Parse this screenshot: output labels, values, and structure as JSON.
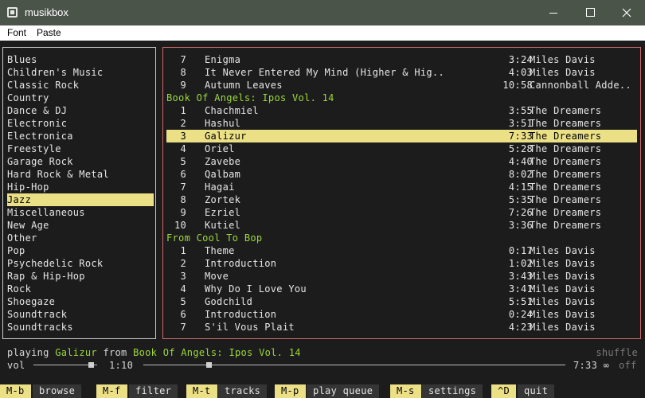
{
  "window": {
    "title": "musikbox"
  },
  "menu": {
    "font": "Font",
    "paste": "Paste"
  },
  "genres": [
    "Blues",
    "Children's Music",
    "Classic Rock",
    "Country",
    "Dance & DJ",
    "Electronic",
    "Electronica",
    "Freestyle",
    "Garage Rock",
    "Hard Rock & Metal",
    "Hip-Hop",
    "Jazz",
    "Miscellaneous",
    "New Age",
    "Other",
    "Pop",
    "Psychedelic Rock",
    "Rap & Hip-Hop",
    "Rock",
    "Shoegaze",
    "Soundtrack",
    "Soundtracks"
  ],
  "selected_genre": "Jazz",
  "tracks": [
    {
      "kind": "track",
      "num": "7",
      "title": "Enigma",
      "duration": "3:24",
      "artist": "Miles Davis"
    },
    {
      "kind": "track",
      "num": "8",
      "title": "It Never Entered My Mind (Higher & Hig..",
      "duration": "4:03",
      "artist": "Miles Davis"
    },
    {
      "kind": "track",
      "num": "9",
      "title": "Autumn Leaves",
      "duration": "10:58",
      "artist": "Cannonball Adde.."
    },
    {
      "kind": "album",
      "title": "Book Of Angels: Ipos Vol. 14"
    },
    {
      "kind": "track",
      "num": "1",
      "title": "Chachmiel",
      "duration": "3:55",
      "artist": "The Dreamers"
    },
    {
      "kind": "track",
      "num": "2",
      "title": "Hashul",
      "duration": "3:51",
      "artist": "The Dreamers"
    },
    {
      "kind": "track",
      "num": "3",
      "title": "Galizur",
      "duration": "7:33",
      "artist": "The Dreamers",
      "selected": true
    },
    {
      "kind": "track",
      "num": "4",
      "title": "Oriel",
      "duration": "5:28",
      "artist": "The Dreamers"
    },
    {
      "kind": "track",
      "num": "5",
      "title": "Zavebe",
      "duration": "4:40",
      "artist": "The Dreamers"
    },
    {
      "kind": "track",
      "num": "6",
      "title": "Qalbam",
      "duration": "8:02",
      "artist": "The Dreamers"
    },
    {
      "kind": "track",
      "num": "7",
      "title": "Hagai",
      "duration": "4:15",
      "artist": "The Dreamers"
    },
    {
      "kind": "track",
      "num": "8",
      "title": "Zortek",
      "duration": "5:35",
      "artist": "The Dreamers"
    },
    {
      "kind": "track",
      "num": "9",
      "title": "Ezriel",
      "duration": "7:26",
      "artist": "The Dreamers"
    },
    {
      "kind": "track",
      "num": "10",
      "title": "Kutiel",
      "duration": "3:36",
      "artist": "The Dreamers"
    },
    {
      "kind": "album",
      "title": "From Cool To Bop"
    },
    {
      "kind": "track",
      "num": "1",
      "title": "Theme",
      "duration": "0:17",
      "artist": "Miles Davis"
    },
    {
      "kind": "track",
      "num": "2",
      "title": "Introduction",
      "duration": "1:02",
      "artist": "Miles Davis"
    },
    {
      "kind": "track",
      "num": "3",
      "title": "Move",
      "duration": "3:43",
      "artist": "Miles Davis"
    },
    {
      "kind": "track",
      "num": "4",
      "title": "Why Do I Love You",
      "duration": "3:41",
      "artist": "Miles Davis"
    },
    {
      "kind": "track",
      "num": "5",
      "title": "Godchild",
      "duration": "5:51",
      "artist": "Miles Davis"
    },
    {
      "kind": "track",
      "num": "6",
      "title": "Introduction",
      "duration": "0:24",
      "artist": "Miles Davis"
    },
    {
      "kind": "track",
      "num": "7",
      "title": "S'il Vous Plait",
      "duration": "4:23",
      "artist": "Miles Davis"
    }
  ],
  "now_playing": {
    "prefix": "playing",
    "track": "Galizur",
    "mid": "from",
    "album": "Book Of Angels: Ipos Vol. 14",
    "shuffle_label": "shuffle"
  },
  "transport": {
    "vol_label": "vol",
    "volume_fraction": 0.9,
    "elapsed": "1:10",
    "progress_fraction": 0.155,
    "total": "7:33",
    "repeat_symbol": "∞",
    "repeat_state": "off"
  },
  "shortcuts": [
    {
      "key": "M-b",
      "action": "browse"
    },
    {
      "key": "M-f",
      "action": "filter"
    },
    {
      "key": "M-t",
      "action": "tracks"
    },
    {
      "key": "M-p",
      "action": "play queue"
    },
    {
      "key": "M-s",
      "action": "settings"
    },
    {
      "key": "^D",
      "action": "quit"
    }
  ],
  "colors": {
    "selection": "#ece087",
    "album_header": "#9bd93b",
    "active_pane_border": "#d06a6a",
    "titlebar": "#4b5449"
  },
  "icons": [
    "app-icon",
    "minimize-icon",
    "maximize-icon",
    "close-icon"
  ]
}
